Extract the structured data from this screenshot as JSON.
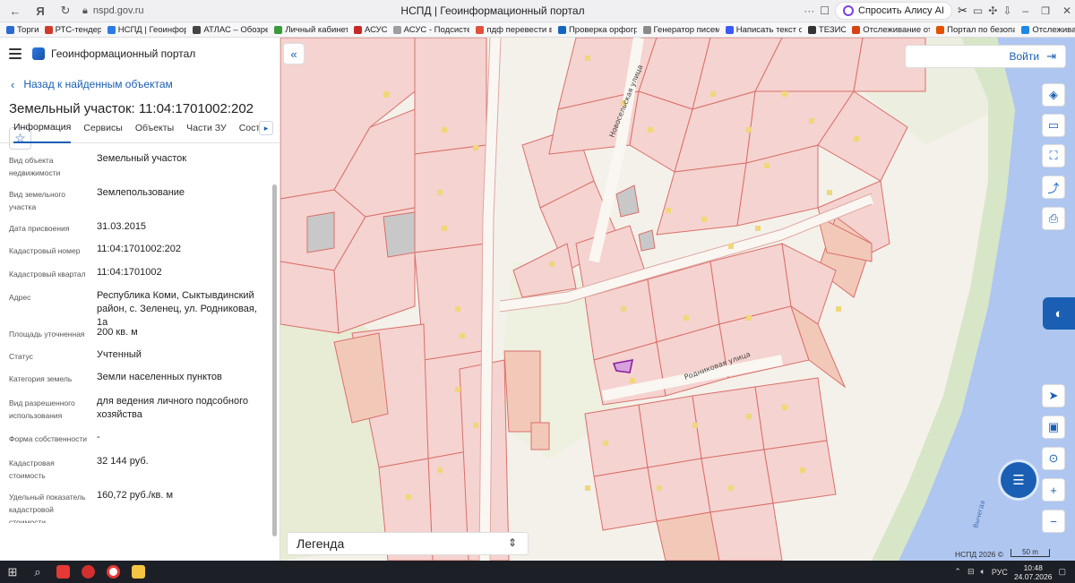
{
  "browser": {
    "url": "nspd.gov.ru",
    "tab_title": "НСПД | Геоинформационный портал",
    "menu_dots": "···",
    "alisa_label": "Спросить Алису AI",
    "bookmarks": [
      {
        "label": "Торги",
        "color": "#2a6bd1"
      },
      {
        "label": "РТС-тендер",
        "color": "#d23b2b"
      },
      {
        "label": "НСПД | Геоинфор",
        "color": "#2c7be5"
      },
      {
        "label": "АТЛАС – Обозре",
        "color": "#444444"
      },
      {
        "label": "Личный кабинет",
        "color": "#3a9a3a"
      },
      {
        "label": "АСУС",
        "color": "#c62828"
      },
      {
        "label": "АСУС - Подсисте",
        "color": "#9e9e9e"
      },
      {
        "label": "пдф перевести в",
        "color": "#e0533a"
      },
      {
        "label": "Проверка орфогр",
        "color": "#1565c0"
      },
      {
        "label": "Генератор писем",
        "color": "#8a8a8a"
      },
      {
        "label": "Написать текст о",
        "color": "#3d5afe"
      },
      {
        "label": "ТЕЗИС",
        "color": "#333333"
      },
      {
        "label": "Отслеживание от",
        "color": "#d84315"
      },
      {
        "label": "Портал по безопа",
        "color": "#e65100"
      },
      {
        "label": "Отслежива",
        "color": "#1e88e5"
      }
    ]
  },
  "sidebar": {
    "portal_name": "Геоинформационный портал",
    "back_label": "Назад к найденным объектам",
    "title": "Земельный участок: 11:04:1701002:202",
    "tabs": [
      "Информация",
      "Сервисы",
      "Объекты",
      "Части ЗУ",
      "Состав"
    ],
    "active_tab": "Информация",
    "properties": [
      {
        "key": "Вид объекта недвижимости",
        "value": "Земельный участок"
      },
      {
        "key": "Вид земельного участка",
        "value": "Землепользование"
      },
      {
        "key": "Дата присвоения",
        "value": "31.03.2015"
      },
      {
        "key": "Кадастровый номер",
        "value": "11:04:1701002:202"
      },
      {
        "key": "Кадастровый квартал",
        "value": "11:04:1701002"
      },
      {
        "key": "Адрес",
        "value": "Республика Коми, Сыктывдинский район, с. Зеленец, ул. Родниковая, 1а"
      },
      {
        "key": "Площадь уточненная",
        "value": "200 кв. м"
      },
      {
        "key": "Статус",
        "value": "Учтенный"
      },
      {
        "key": "Категория земель",
        "value": "Земли населенных пунктов"
      },
      {
        "key": "Вид разрешенного использования",
        "value": "для ведения личного подсобного хозяйства"
      },
      {
        "key": "Форма собственности",
        "value": "-"
      },
      {
        "key": "Кадастровая стоимость",
        "value": "32 144 руб."
      },
      {
        "key": "Удельный показатель кадастровой стоимости",
        "value": "160,72 руб./кв. м"
      }
    ]
  },
  "map": {
    "login_label": "Войти",
    "legend_label": "Легенда",
    "copyright": "НСПД 2026 ©",
    "scale_label": "50 m",
    "street_labels": [
      "Новосельская улица",
      "Родниковая улица",
      "Вычегда"
    ],
    "colors": {
      "parcel_fill": "#f5d3d0",
      "parcel_stroke": "#d9706a",
      "river": "#aec6f0",
      "meadow": "#e8ecd4",
      "road": "#faf7f2",
      "selected": "#8b1fa0",
      "accent": "#1a5fb4"
    }
  },
  "taskbar": {
    "language": "РУС",
    "time": "10:48",
    "date": "24.07.2026"
  }
}
